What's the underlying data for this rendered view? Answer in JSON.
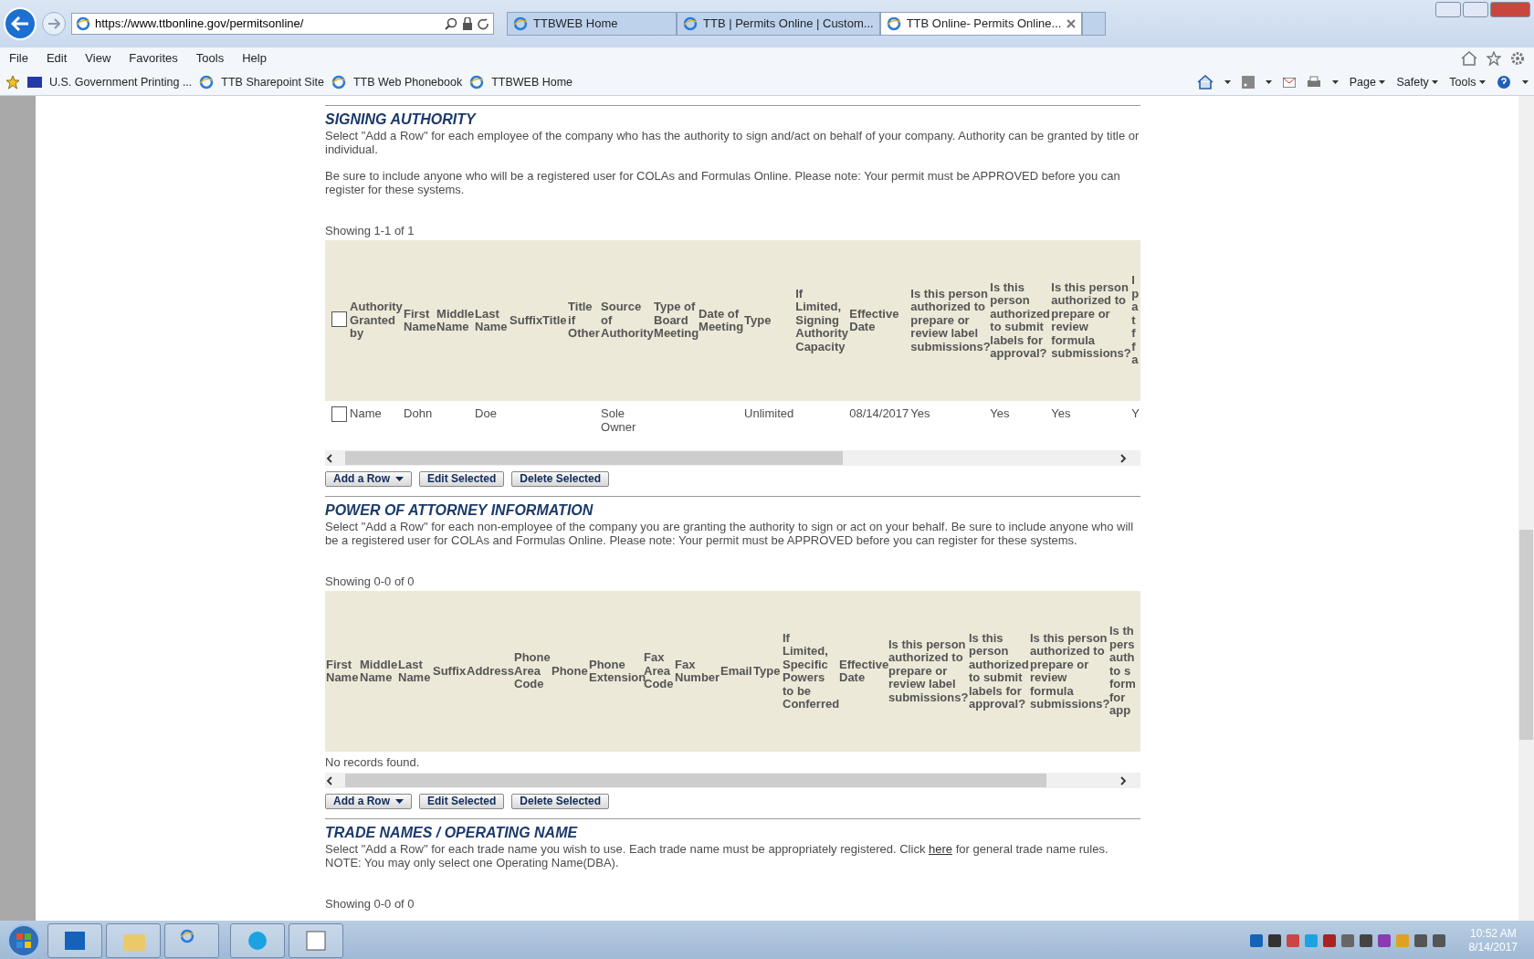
{
  "browser": {
    "address": "https://www.ttbonline.gov/permitsonline/",
    "tabs": [
      {
        "label": "TTBWEB Home",
        "selected": false
      },
      {
        "label": "TTB | Permits Online | Custom...",
        "selected": false
      },
      {
        "label": "TTB Online- Permits Online...",
        "selected": true
      }
    ],
    "menu": [
      "File",
      "Edit",
      "View",
      "Favorites",
      "Tools",
      "Help"
    ],
    "favorites": [
      "U.S. Government Printing ...",
      "TTB Sharepoint Site",
      "TTB Web Phonebook",
      "TTBWEB Home"
    ],
    "command_bar": [
      "Page",
      "Safety",
      "Tools"
    ]
  },
  "sections": [
    {
      "title": "SIGNING AUTHORITY",
      "paragraphs": [
        {
          "text": "Select \"Add a Row\" for each employee of the company who has the authority to sign and/act on behalf of your company. Authority can be granted by title or individual."
        },
        {
          "text": "Be sure to include anyone who will be a registered user for COLAs and Formulas Online. Please note: Your permit must be APPROVED before you can register for these systems."
        }
      ],
      "showing": "Showing 1-1 of 1",
      "select_all": {
        "checked": false
      },
      "columns": [
        "Authority Granted by",
        "First Name",
        "Middle Name",
        "Last Name",
        "Suffix",
        "Title",
        "Title if Other",
        "Source of Authority",
        "Type of Board Meeting",
        "Date of Meeting",
        "Type",
        "If Limited, Signing Authority Capacity",
        "Effective Date",
        "Is this person authorized to prepare or review label submissions?",
        "Is this person authorized to submit labels for approval?",
        "Is this person authorized to prepare or review formula submissions?",
        "I p a t f f a"
      ],
      "rows": [
        {
          "checked": false,
          "cells": [
            "Name",
            "Dohn",
            "",
            "Doe",
            "",
            "",
            "",
            "Sole Owner",
            "",
            "",
            "Unlimited",
            "",
            "08/14/2017",
            "Yes",
            "Yes",
            "Yes",
            "Y"
          ]
        }
      ],
      "buttons": [
        "Add a Row",
        "Edit Selected",
        "Delete Selected"
      ]
    },
    {
      "title": "POWER OF ATTORNEY INFORMATION",
      "paragraphs": [
        {
          "text": "Select \"Add a Row\" for each non-employee of the company you are granting the authority to sign or act on your behalf. Be sure to include anyone who will be a registered user for COLAs and Formulas Online. Please note: Your permit must be APPROVED before you can register for these systems."
        }
      ],
      "showing": "Showing 0-0 of 0",
      "columns": [
        "First Name",
        "Middle Name",
        "Last Name",
        "Suffix",
        "Address",
        "Phone Area Code",
        "Phone",
        "Phone Extension",
        "Fax Area Code",
        "Fax Number",
        "Email",
        "Type",
        "If Limited, Specific Powers to be Conferred",
        "Effective Date",
        "Is this person authorized to prepare or review label submissions?",
        "Is this person authorized to submit labels for approval?",
        "Is this person authorized to prepare or review formula submissions?",
        "Is th pers auth to s form for app"
      ],
      "empty_text": "No records found.",
      "buttons": [
        "Add a Row",
        "Edit Selected",
        "Delete Selected"
      ]
    },
    {
      "title": "TRADE NAMES / OPERATING NAME",
      "paragraphs": [
        {
          "text": "Select \"Add a Row\" for each trade name you wish to use. Each trade name must be appropriately registered. Click ",
          "link": "here",
          "after": " for general trade name rules. NOTE: You may only select one Operating Name(DBA)."
        }
      ],
      "showing": "Showing 0-0 of 0"
    }
  ],
  "taskbar": {
    "time": "10:52 AM",
    "date": "8/14/2017"
  }
}
